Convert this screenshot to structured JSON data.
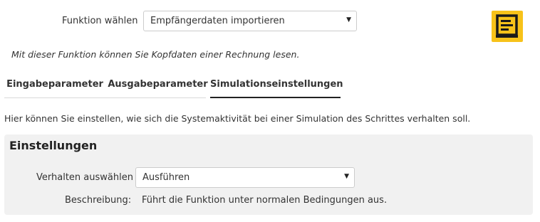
{
  "function": {
    "label": "Funktion wählen",
    "selected": "Empfängerdaten importieren"
  },
  "logo": {
    "icon": "document-lines-icon",
    "color": "#f7c21a"
  },
  "description": "Mit dieser Funktion können Sie Kopfdaten einer Rechnung lesen.",
  "tabs": [
    {
      "label": "Eingabeparameter",
      "active": false
    },
    {
      "label": "Ausgabeparameter",
      "active": false
    },
    {
      "label": "Simulationseinstellungen",
      "active": true
    }
  ],
  "info": "Hier können Sie einstellen, wie sich die Systemaktivität bei einer Simulation des Schrittes verhalten soll.",
  "settings": {
    "title": "Einstellungen",
    "behavior_label": "Verhalten auswählen",
    "behavior_selected": "Ausführen",
    "description_label": "Beschreibung:",
    "description_value": "Führt die Funktion unter normalen Bedingungen aus."
  }
}
